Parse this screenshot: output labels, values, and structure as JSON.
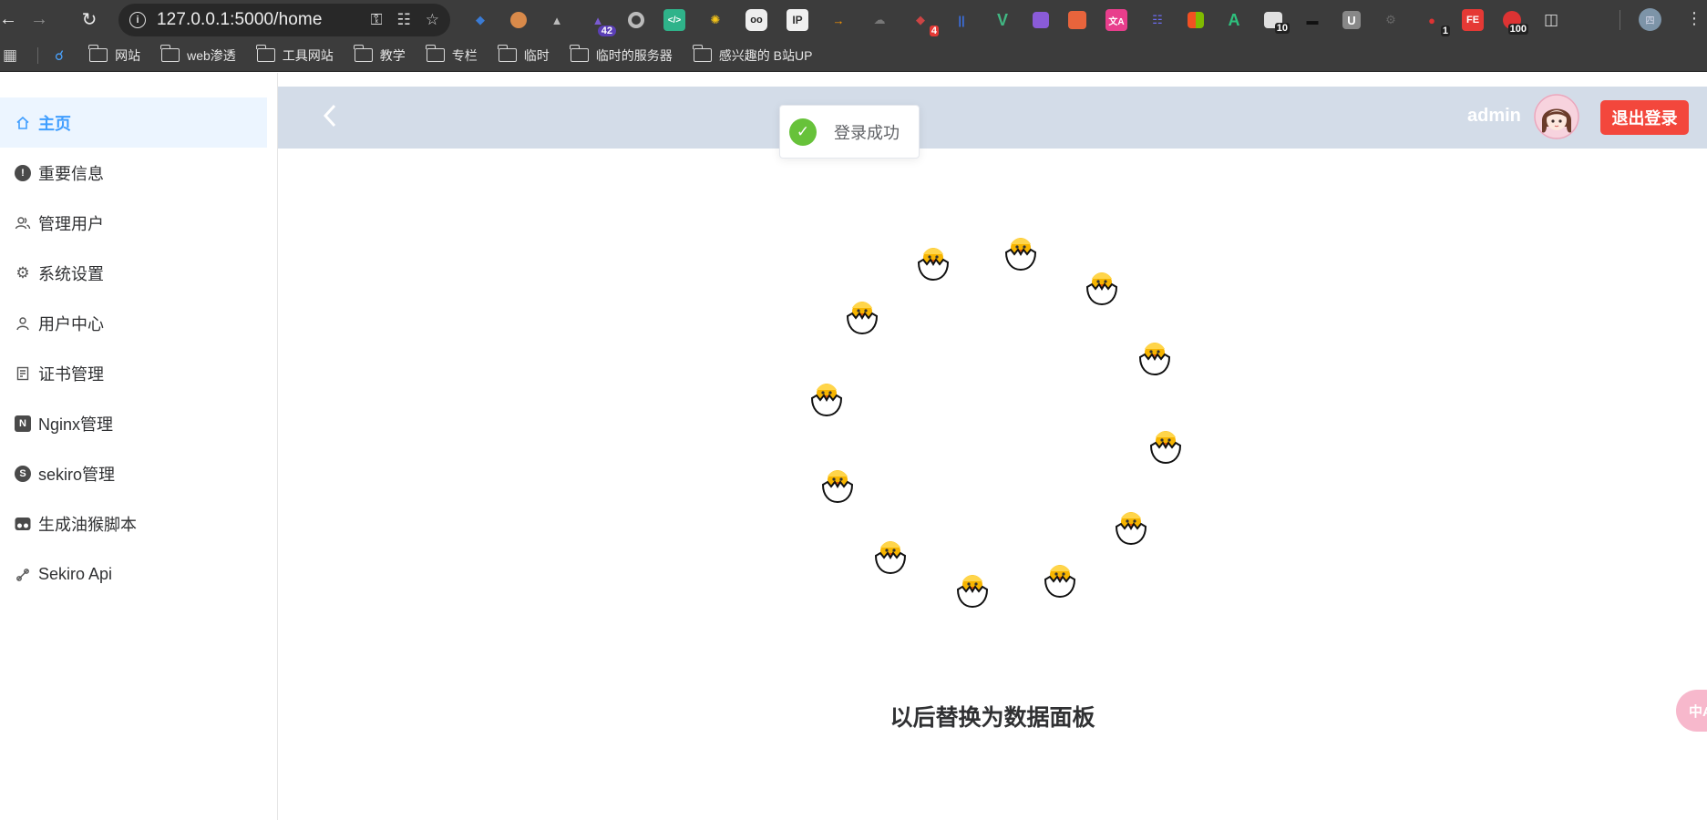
{
  "browser": {
    "url": "127.0.0.1:5000/home",
    "extension_badges": [
      "42",
      "4",
      "10",
      "1",
      "100"
    ],
    "extension_labels": {
      "fe": "FE",
      "u": "U"
    },
    "profile_label": "四",
    "bookmarks": [
      "网站",
      "web渗透",
      "工具网站",
      "教学",
      "专栏",
      "临时",
      "临时的服务器",
      "感兴趣的 B站UP"
    ]
  },
  "sidebar": {
    "items": [
      {
        "label": "主页",
        "icon": "home-icon"
      },
      {
        "label": "重要信息",
        "icon": "warning-icon"
      },
      {
        "label": "管理用户",
        "icon": "users-icon"
      },
      {
        "label": "系统设置",
        "icon": "gear-icon"
      },
      {
        "label": "用户中心",
        "icon": "user-icon"
      },
      {
        "label": "证书管理",
        "icon": "certificate-icon"
      },
      {
        "label": "Nginx管理",
        "icon": "nginx-icon"
      },
      {
        "label": "sekiro管理",
        "icon": "sekiro-icon"
      },
      {
        "label": "生成油猴脚本",
        "icon": "tampermonkey-icon"
      },
      {
        "label": "Sekiro Api",
        "icon": "link-icon"
      }
    ]
  },
  "header": {
    "username": "admin",
    "logout_label": "退出登录"
  },
  "toast": {
    "message": "登录成功"
  },
  "main": {
    "caption": "以后替换为数据面板"
  },
  "float_button": {
    "label": "中A"
  },
  "colors": {
    "accent": "#409eff",
    "header_bg": "#d3dce8",
    "logout": "#f3473c",
    "success": "#67c23a"
  }
}
